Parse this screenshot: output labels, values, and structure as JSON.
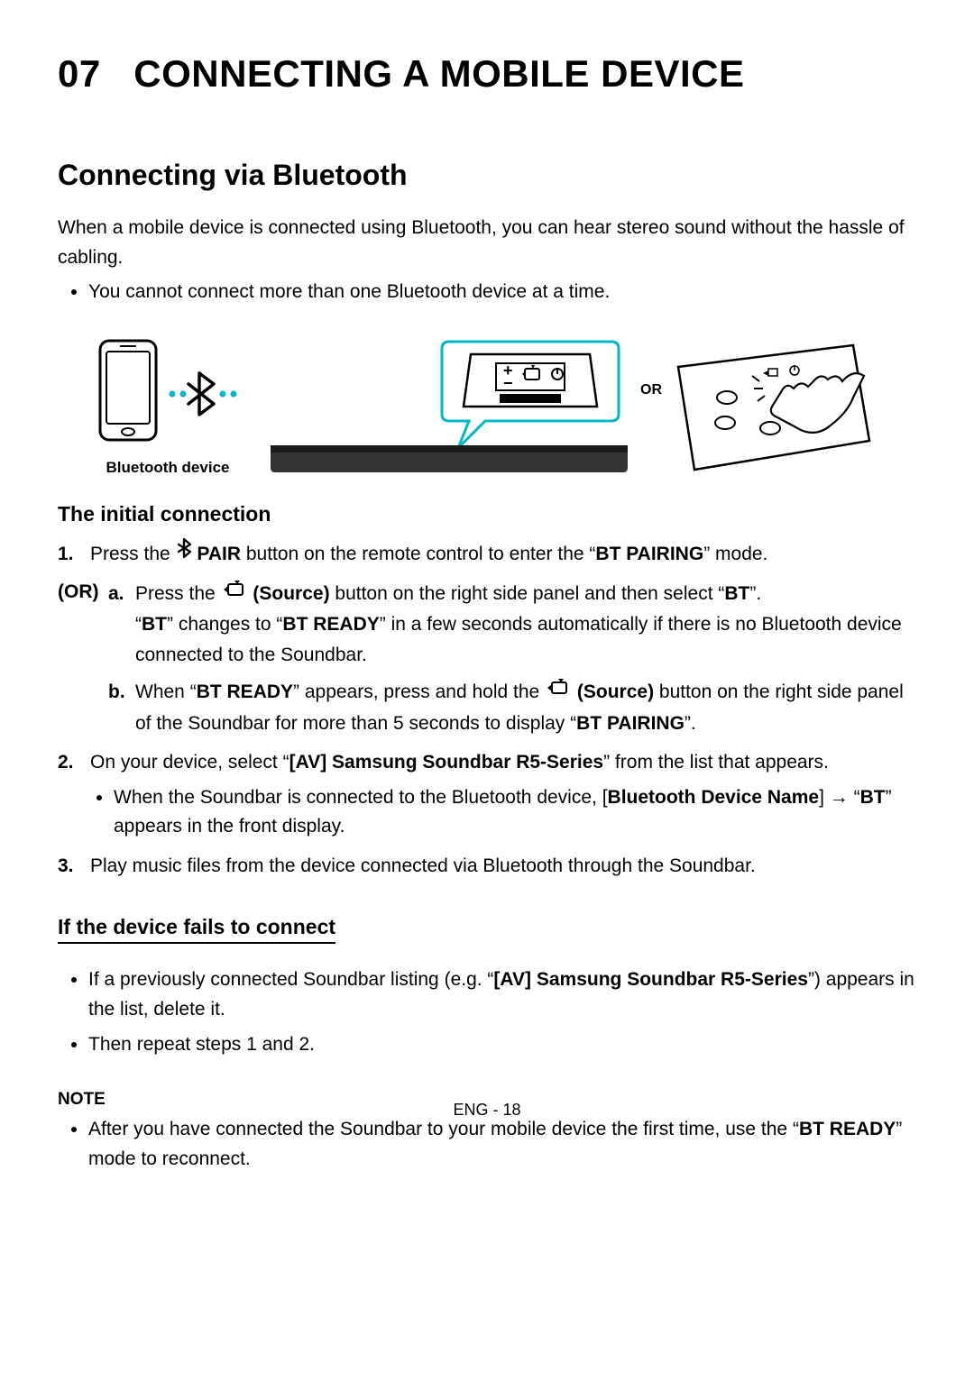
{
  "chapter": {
    "number": "07",
    "title": "CONNECTING A MOBILE DEVICE"
  },
  "section": {
    "title": "Connecting via Bluetooth"
  },
  "intro": "When a mobile device is connected using Bluetooth, you can hear stereo sound without the hassle of cabling.",
  "intro_bullet": "You cannot connect more than one Bluetooth device at a time.",
  "illus": {
    "bt_device_label": "Bluetooth device",
    "or_label": "OR"
  },
  "initial": {
    "heading": "The initial connection",
    "step1_pre": "Press the ",
    "step1_bold": " PAIR",
    "step1_mid": " button on the remote control to enter the “",
    "step1_mode": "BT PAIRING",
    "step1_end": "” mode.",
    "or_label": "(OR)",
    "a_pre": "Press the ",
    "a_bold": " (Source)",
    "a_mid": " button on the right side panel and then select “",
    "a_bt": "BT",
    "a_close": "”.",
    "a_line2_open": "“",
    "a_bt2": "BT",
    "a_line2_mid": "” changes to “",
    "a_btready": "BT READY",
    "a_line2_end": "” in a few seconds automatically if there is no Bluetooth device connected to the Soundbar.",
    "b_pre": "When “",
    "b_btready": "BT READY",
    "b_mid": "” appears, press and hold the ",
    "b_bold": " (Source)",
    "b_end": " button on the right side panel of the Soundbar for more than 5 seconds to display “",
    "b_pairing": "BT PAIRING",
    "b_close": "”.",
    "step2_pre": "On your device, select “",
    "step2_bold": "[AV] Samsung Soundbar R5-Series",
    "step2_end": "” from the list that appears.",
    "step2_bullet_pre": "When the Soundbar is connected to the Bluetooth device, [",
    "step2_bullet_bold": "Bluetooth Device Name",
    "step2_bullet_mid": "] → “",
    "step2_bullet_bt": "BT",
    "step2_bullet_end": "” appears in the front display.",
    "step3": "Play music files from the device connected via Bluetooth through the Soundbar."
  },
  "fail": {
    "heading": "If the device fails to connect",
    "b1_pre": "If a previously connected Soundbar listing (e.g. “",
    "b1_bold": "[AV] Samsung Soundbar R5-Series",
    "b1_end": "”) appears in the list, delete it.",
    "b2": "Then repeat steps 1 and 2."
  },
  "note": {
    "label": "NOTE",
    "b1_pre": "After you have connected the Soundbar to your mobile device the first time, use the “",
    "b1_bold": "BT READY",
    "b1_end": "” mode to reconnect."
  },
  "footer": "ENG - 18"
}
